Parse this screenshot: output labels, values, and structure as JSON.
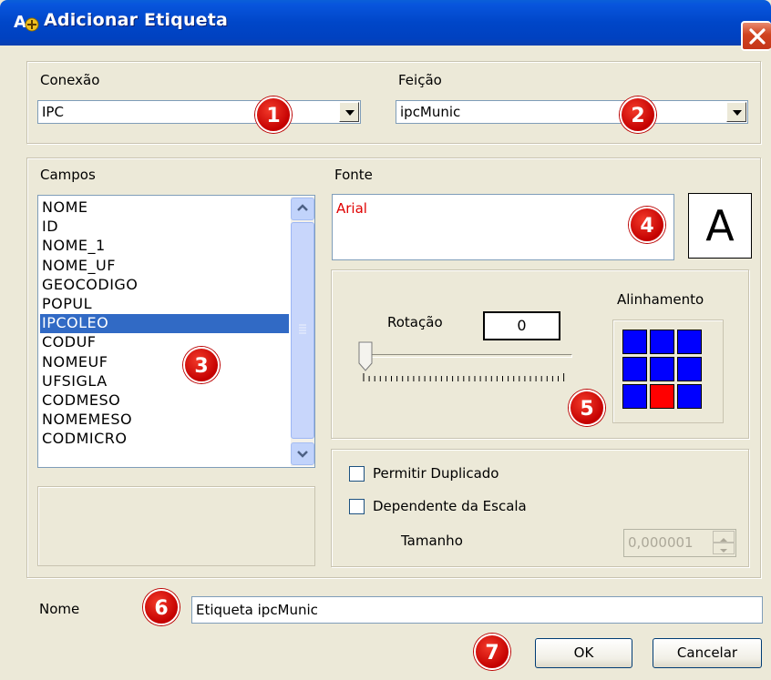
{
  "window": {
    "title": "Adicionar Etiqueta"
  },
  "connection": {
    "label": "Conexão",
    "value": "IPC"
  },
  "feature": {
    "label": "Feição",
    "value": "ipcMunic"
  },
  "fields": {
    "label": "Campos",
    "items": [
      "NOME",
      "ID",
      "NOME_1",
      "NOME_UF",
      "GEOCODIGO",
      "POPUL",
      "IPCOLEO",
      "CODUF",
      "NOMEUF",
      "UFSIGLA",
      "CODMESO",
      "NOMEMESO",
      "CODMICRO"
    ],
    "selected_index": 6
  },
  "font": {
    "label": "Fonte",
    "value": "Arial",
    "button_glyph": "A"
  },
  "rotation": {
    "label": "Rotação",
    "value": "0"
  },
  "alignment": {
    "label": "Alinhamento",
    "selected_cell": 7
  },
  "options": {
    "allow_duplicate": "Permitir Duplicado",
    "scale_dependent": "Dependente da Escala",
    "size_label": "Tamanho",
    "size_value": "0,000001"
  },
  "name": {
    "label": "Nome",
    "value": "Etiqueta ipcMunic"
  },
  "buttons": {
    "ok": "OK",
    "cancel": "Cancelar"
  },
  "badges": [
    "1",
    "2",
    "3",
    "4",
    "5",
    "6",
    "7"
  ],
  "colors": {
    "titlebar": "#0046c8",
    "selection": "#316ac5",
    "align_cell": "#0000ff",
    "align_active": "#ff0000",
    "badge": "#d00000",
    "font_text": "#e00000"
  }
}
